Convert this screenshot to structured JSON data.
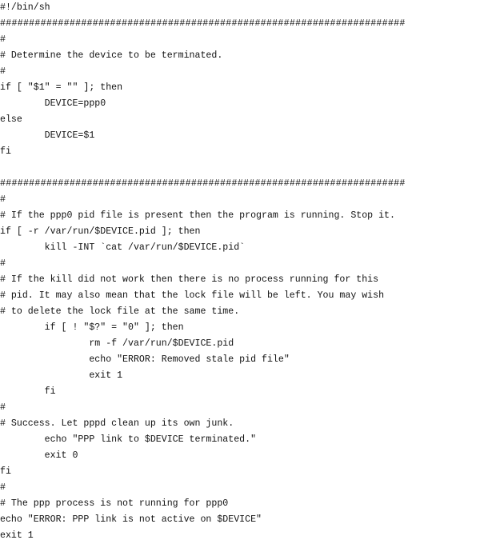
{
  "script": {
    "lines": [
      "#!/bin/sh",
      "######################################################################",
      "#",
      "# Determine the device to be terminated.",
      "#",
      "if [ \"$1\" = \"\" ]; then",
      "        DEVICE=ppp0",
      "else",
      "        DEVICE=$1",
      "fi",
      "",
      "######################################################################",
      "#",
      "# If the ppp0 pid file is present then the program is running. Stop it.",
      "if [ -r /var/run/$DEVICE.pid ]; then",
      "        kill -INT `cat /var/run/$DEVICE.pid`",
      "#",
      "# If the kill did not work then there is no process running for this",
      "# pid. It may also mean that the lock file will be left. You may wish",
      "# to delete the lock file at the same time.",
      "        if [ ! \"$?\" = \"0\" ]; then",
      "                rm -f /var/run/$DEVICE.pid",
      "                echo \"ERROR: Removed stale pid file\"",
      "                exit 1",
      "        fi",
      "#",
      "# Success. Let pppd clean up its own junk.",
      "        echo \"PPP link to $DEVICE terminated.\"",
      "        exit 0",
      "fi",
      "#",
      "# The ppp process is not running for ppp0",
      "echo \"ERROR: PPP link is not active on $DEVICE\"",
      "exit 1"
    ]
  }
}
